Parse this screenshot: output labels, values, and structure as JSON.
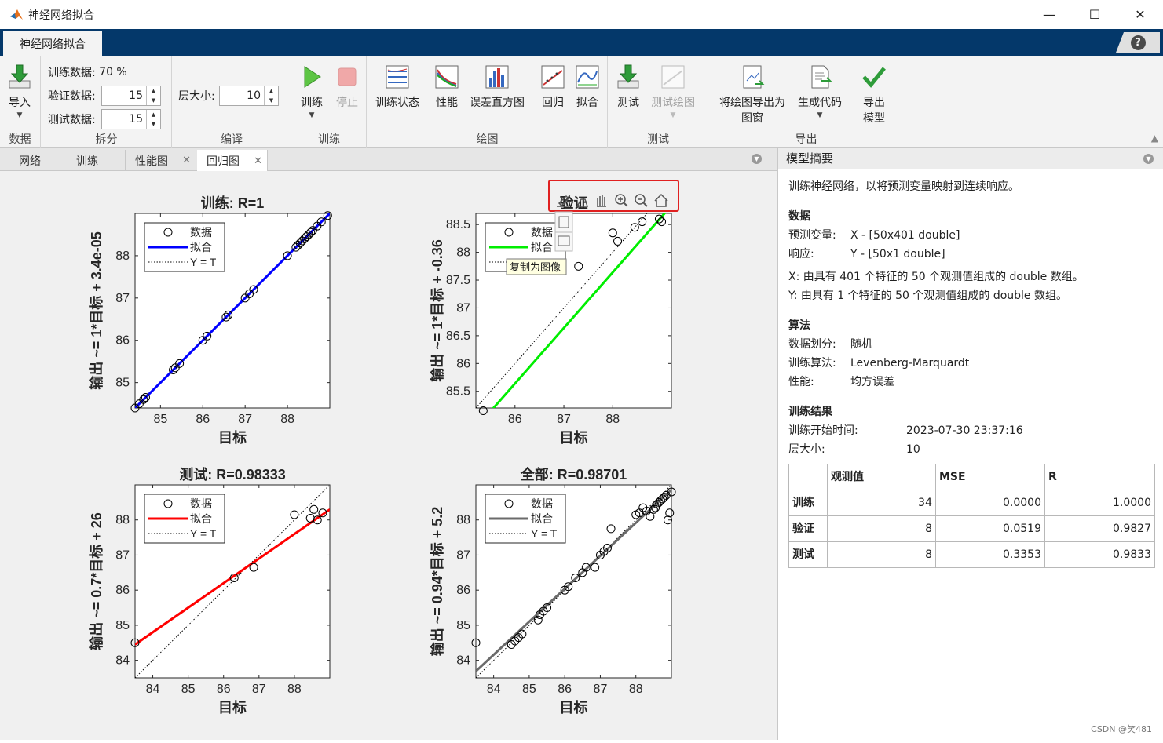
{
  "window": {
    "title": "神经网络拟合",
    "minimize": "—",
    "maximize": "☐",
    "close": "✕"
  },
  "ribbon_tab": {
    "label": "神经网络拟合",
    "help": "?"
  },
  "ribbon": {
    "data": {
      "import_label": "导入",
      "section": "数据"
    },
    "split": {
      "train_label": "训练数据:",
      "train_value": "70 %",
      "val_label": "验证数据:",
      "val_value": "15",
      "test_label": "测试数据:",
      "test_value": "15",
      "section": "拆分"
    },
    "compile": {
      "layer_label": "层大小:",
      "layer_value": "10",
      "section": "编译"
    },
    "train": {
      "train_label": "训练",
      "stop_label": "停止",
      "section": "训练"
    },
    "plots": {
      "items": [
        "训练状态",
        "性能",
        "误差直方图",
        "回归",
        "拟合"
      ],
      "section": "绘图"
    },
    "test": {
      "test_label": "测试",
      "testplot_label": "测试绘图",
      "section": "测试"
    },
    "export": {
      "export_fig_label": "将绘图导出为图窗",
      "gen_code_label": "生成代码",
      "export_model_label": "导出模型",
      "section": "导出"
    }
  },
  "doc_tabs": [
    {
      "label": "网络"
    },
    {
      "label": "训练"
    },
    {
      "label": "性能图",
      "closable": true
    },
    {
      "label": "回归图",
      "closable": true,
      "active": true
    }
  ],
  "tooltip": "复制为图像",
  "summary": {
    "header": "模型摘要",
    "intro": "训练神经网络，以将预测变量映射到连续响应。",
    "data": {
      "title": "数据",
      "predictor_k": "预测变量:",
      "predictor_v": "X - [50x401 double]",
      "response_k": "响应:",
      "response_v": "Y - [50x1 double]",
      "x_desc": "X: 由具有 401 个特征的 50 个观测值组成的 double 数组。",
      "y_desc": "Y: 由具有 1 个特征的 50 个观测值组成的 double 数组。"
    },
    "algo": {
      "title": "算法",
      "split_k": "数据划分:",
      "split_v": "随机",
      "train_k": "训练算法:",
      "train_v": "Levenberg-Marquardt",
      "perf_k": "性能:",
      "perf_v": "均方误差"
    },
    "results": {
      "title": "训练结果",
      "start_k": "训练开始时间:",
      "start_v": "2023-07-30 23:37:16",
      "layer_k": "层大小:",
      "layer_v": "10",
      "table": {
        "headers": [
          "",
          "观测值",
          "MSE",
          "R"
        ],
        "rows": [
          [
            "训练",
            "34",
            "0.0000",
            "1.0000"
          ],
          [
            "验证",
            "8",
            "0.0519",
            "0.9827"
          ],
          [
            "测试",
            "8",
            "0.3353",
            "0.9833"
          ]
        ]
      }
    }
  },
  "watermark": "CSDN @笑481",
  "chart_data": [
    {
      "type": "scatter",
      "title": "训练: R=1",
      "xlabel": "目标",
      "ylabel": "输出 ~= 1*目标 + 3.4e-05",
      "xlim": [
        84.4,
        89
      ],
      "ylim": [
        84.4,
        89
      ],
      "xticks": [
        85,
        86,
        87,
        88
      ],
      "yticks": [
        85,
        86,
        87,
        88
      ],
      "fit_color": "#0000ff",
      "legend": [
        "数据",
        "拟合",
        "Y = T"
      ],
      "fit": {
        "slope": 1,
        "intercept": 3.4e-05
      },
      "x": [
        84.4,
        84.5,
        84.6,
        84.65,
        85.3,
        85.35,
        85.45,
        86,
        86.1,
        86.55,
        86.6,
        87,
        87.1,
        87.2,
        88,
        88.2,
        88.25,
        88.3,
        88.35,
        88.4,
        88.45,
        88.5,
        88.55,
        88.6,
        88.7,
        88.8,
        88.95
      ],
      "y": [
        84.4,
        84.5,
        84.6,
        84.65,
        85.3,
        85.35,
        85.45,
        86,
        86.1,
        86.55,
        86.6,
        87,
        87.1,
        87.2,
        88,
        88.2,
        88.25,
        88.3,
        88.35,
        88.4,
        88.45,
        88.5,
        88.55,
        88.6,
        88.7,
        88.8,
        88.95
      ]
    },
    {
      "type": "scatter",
      "title": "验证",
      "xlabel": "目标",
      "ylabel": "输出 ~= 1*目标 + -0.36",
      "xlim": [
        85.2,
        89.2
      ],
      "ylim": [
        85.2,
        88.7
      ],
      "xticks": [
        86,
        87,
        88
      ],
      "yticks": [
        85.5,
        86,
        86.5,
        87,
        87.5,
        88,
        88.5
      ],
      "fit_color": "#00ee00",
      "legend": [
        "数据",
        "拟合",
        "Y = T"
      ],
      "fit": {
        "slope": 1,
        "intercept": -0.36
      },
      "x": [
        85.35,
        87.3,
        88,
        88.1,
        88.45,
        88.6,
        88.95,
        89
      ],
      "y": [
        85.15,
        87.75,
        88.35,
        88.2,
        88.45,
        88.55,
        88.6,
        88.55
      ]
    },
    {
      "type": "scatter",
      "title": "测试: R=0.98333",
      "xlabel": "目标",
      "ylabel": "输出 ~= 0.7*目标 + 26",
      "xlim": [
        83.5,
        89
      ],
      "ylim": [
        83.5,
        89
      ],
      "xticks": [
        84,
        85,
        86,
        87,
        88
      ],
      "yticks": [
        84,
        85,
        86,
        87,
        88
      ],
      "fit_color": "#ff0000",
      "legend": [
        "数据",
        "拟合",
        "Y = T"
      ],
      "fit": {
        "slope": 0.7,
        "intercept": 26
      },
      "x": [
        83.5,
        86.3,
        86.85,
        88,
        88.45,
        88.55,
        88.65,
        88.8
      ],
      "y": [
        84.5,
        86.35,
        86.65,
        88.15,
        88.05,
        88.3,
        88,
        88.2
      ]
    },
    {
      "type": "scatter",
      "title": "全部: R=0.98701",
      "xlabel": "目标",
      "ylabel": "输出 ~= 0.94*目标 + 5.2",
      "xlim": [
        83.5,
        89
      ],
      "ylim": [
        83.5,
        89
      ],
      "xticks": [
        84,
        85,
        86,
        87,
        88
      ],
      "yticks": [
        84,
        85,
        86,
        87,
        88
      ],
      "fit_color": "#6b6b6b",
      "legend": [
        "数据",
        "拟合",
        "Y = T"
      ],
      "fit": {
        "slope": 0.94,
        "intercept": 5.2
      },
      "x": [
        83.5,
        84.5,
        84.6,
        84.7,
        84.8,
        85.25,
        85.3,
        85.4,
        85.5,
        86,
        86.1,
        86.3,
        86.5,
        86.6,
        86.85,
        87,
        87.1,
        87.2,
        87.3,
        88,
        88.1,
        88.2,
        88.3,
        88.4,
        88.5,
        88.55,
        88.6,
        88.65,
        88.7,
        88.75,
        88.8,
        88.85,
        88.9,
        88.95,
        89
      ],
      "y": [
        84.5,
        84.45,
        84.55,
        84.65,
        84.75,
        85.15,
        85.3,
        85.4,
        85.5,
        86,
        86.1,
        86.35,
        86.5,
        86.65,
        86.65,
        87,
        87.1,
        87.2,
        87.75,
        88.15,
        88.2,
        88.35,
        88.25,
        88.1,
        88.3,
        88.35,
        88.45,
        88.5,
        88.55,
        88.6,
        88.65,
        88.7,
        88,
        88.2,
        88.8
      ]
    }
  ]
}
